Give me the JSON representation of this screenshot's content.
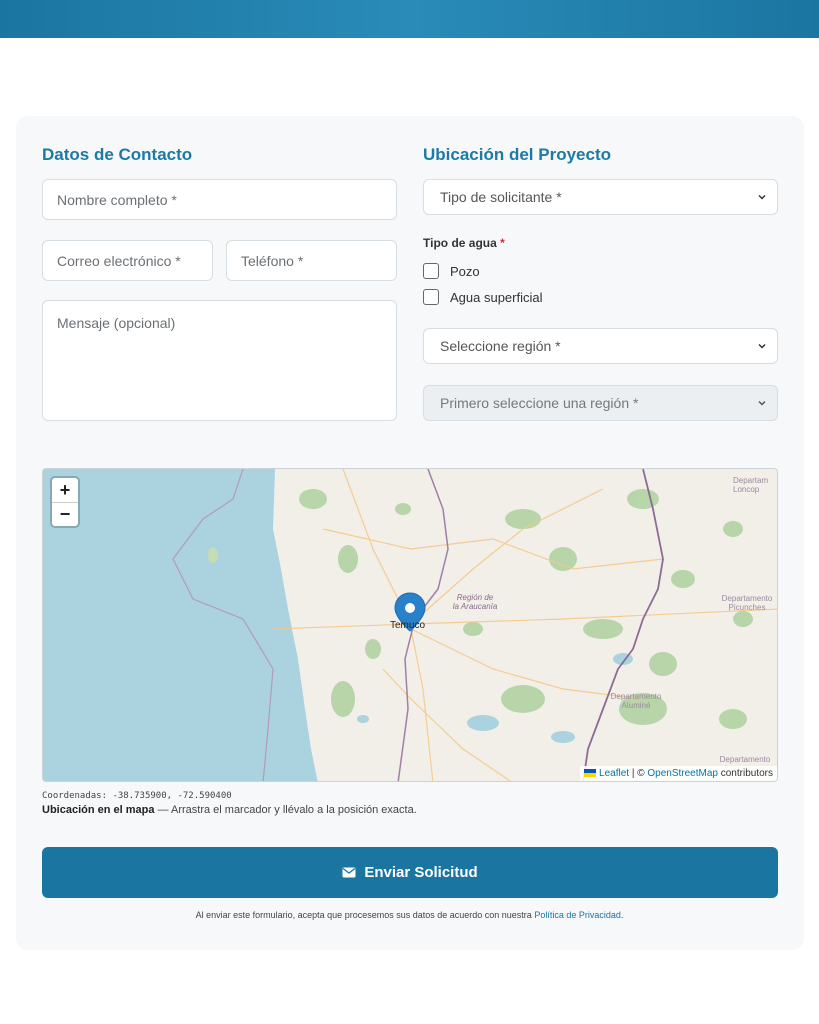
{
  "contact": {
    "title": "Datos de Contacto",
    "name_placeholder": "Nombre completo *",
    "email_placeholder": "Correo electrónico *",
    "phone_placeholder": "Teléfono *",
    "message_placeholder": "Mensaje (opcional)"
  },
  "location": {
    "title": "Ubicación del Proyecto",
    "applicant_type": "Tipo de solicitante *",
    "water_type_label": "Tipo de agua",
    "required_mark": "*",
    "water_options": [
      {
        "label": "Pozo",
        "checked": false
      },
      {
        "label": "Agua superficial",
        "checked": false
      }
    ],
    "region_select": "Seleccione región *",
    "commune_select": "Primero seleccione una región *"
  },
  "map": {
    "zoom_in": "+",
    "zoom_out": "−",
    "city_label": "Temuco",
    "region_label_line1": "Región de",
    "region_label_line2": "la Araucanía",
    "labels": [
      {
        "line1": "Departam",
        "line2": "Loncop"
      },
      {
        "line1": "Departamento",
        "line2": "Picunches"
      },
      {
        "line1": "Departamento",
        "line2": "Aluminé"
      },
      {
        "line1": "Departamento",
        "line2": ""
      }
    ],
    "attribution": {
      "leaflet": "Leaflet",
      "separator": " | © ",
      "osm": "OpenStreetMap",
      "contributors": " contributors"
    },
    "colors": {
      "water": "#aad3df",
      "land": "#f2efe9",
      "forest": "#add19e",
      "border": "#9e7fa7"
    }
  },
  "coordinates": {
    "label": "Coordenadas:",
    "value": "-38.735900, -72.590400"
  },
  "hint": {
    "bold": "Ubicación en el mapa",
    "text": " — Arrastra el marcador y llévalo a la posición exacta."
  },
  "submit": {
    "label": "Enviar Solicitud",
    "icon": "envelope-icon"
  },
  "privacy": {
    "text": "Al enviar este formulario, acepta que procesemos sus datos de acuerdo con nuestra ",
    "link": "Política de Privacidad",
    "end": "."
  },
  "theme": {
    "accent": "#1b75a1",
    "title_color": "#1b7aa6"
  }
}
